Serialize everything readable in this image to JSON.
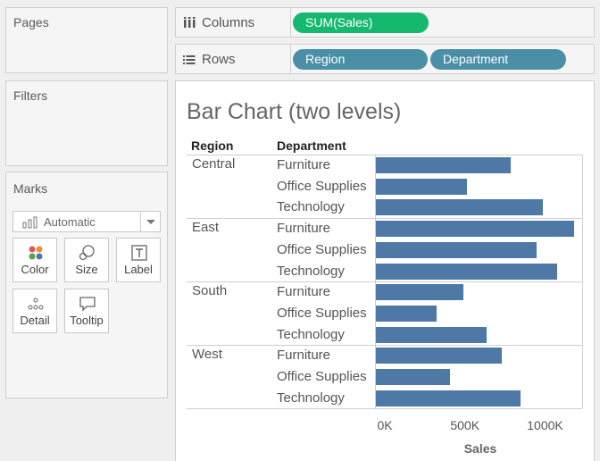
{
  "pages": {
    "title": "Pages"
  },
  "filters": {
    "title": "Filters"
  },
  "marks": {
    "title": "Marks",
    "mark_type": "Automatic",
    "buttons": [
      "Color",
      "Size",
      "Label",
      "Detail",
      "Tooltip"
    ]
  },
  "columns": {
    "label": "Columns",
    "pills": [
      "SUM(Sales)"
    ]
  },
  "rows": {
    "label": "Rows",
    "pills": [
      "Region",
      "Department"
    ]
  },
  "view": {
    "title": "Bar Chart (two levels)",
    "headers": {
      "region": "Region",
      "department": "Department"
    }
  },
  "colors": {
    "bar": "#4e79a7",
    "measure_pill": "#15b86f",
    "dimension_pill": "#4a8fa6"
  },
  "chart_data": {
    "type": "bar",
    "orientation": "horizontal",
    "groups": [
      {
        "region": "Central",
        "rows": [
          {
            "department": "Furniture",
            "value": 780000
          },
          {
            "department": "Office Supplies",
            "value": 530000
          },
          {
            "department": "Technology",
            "value": 970000
          }
        ]
      },
      {
        "region": "East",
        "rows": [
          {
            "department": "Furniture",
            "value": 1150000
          },
          {
            "department": "Office Supplies",
            "value": 930000
          },
          {
            "department": "Technology",
            "value": 1050000
          }
        ]
      },
      {
        "region": "South",
        "rows": [
          {
            "department": "Furniture",
            "value": 510000
          },
          {
            "department": "Office Supplies",
            "value": 350000
          },
          {
            "department": "Technology",
            "value": 640000
          }
        ]
      },
      {
        "region": "West",
        "rows": [
          {
            "department": "Furniture",
            "value": 730000
          },
          {
            "department": "Office Supplies",
            "value": 430000
          },
          {
            "department": "Technology",
            "value": 840000
          }
        ]
      }
    ],
    "xlabel": "Sales",
    "ticks": [
      {
        "value": 0,
        "label": "0K"
      },
      {
        "value": 500000,
        "label": "500K"
      },
      {
        "value": 1000000,
        "label": "1000K"
      }
    ],
    "xlim": [
      0,
      1150000
    ],
    "grid": false
  }
}
